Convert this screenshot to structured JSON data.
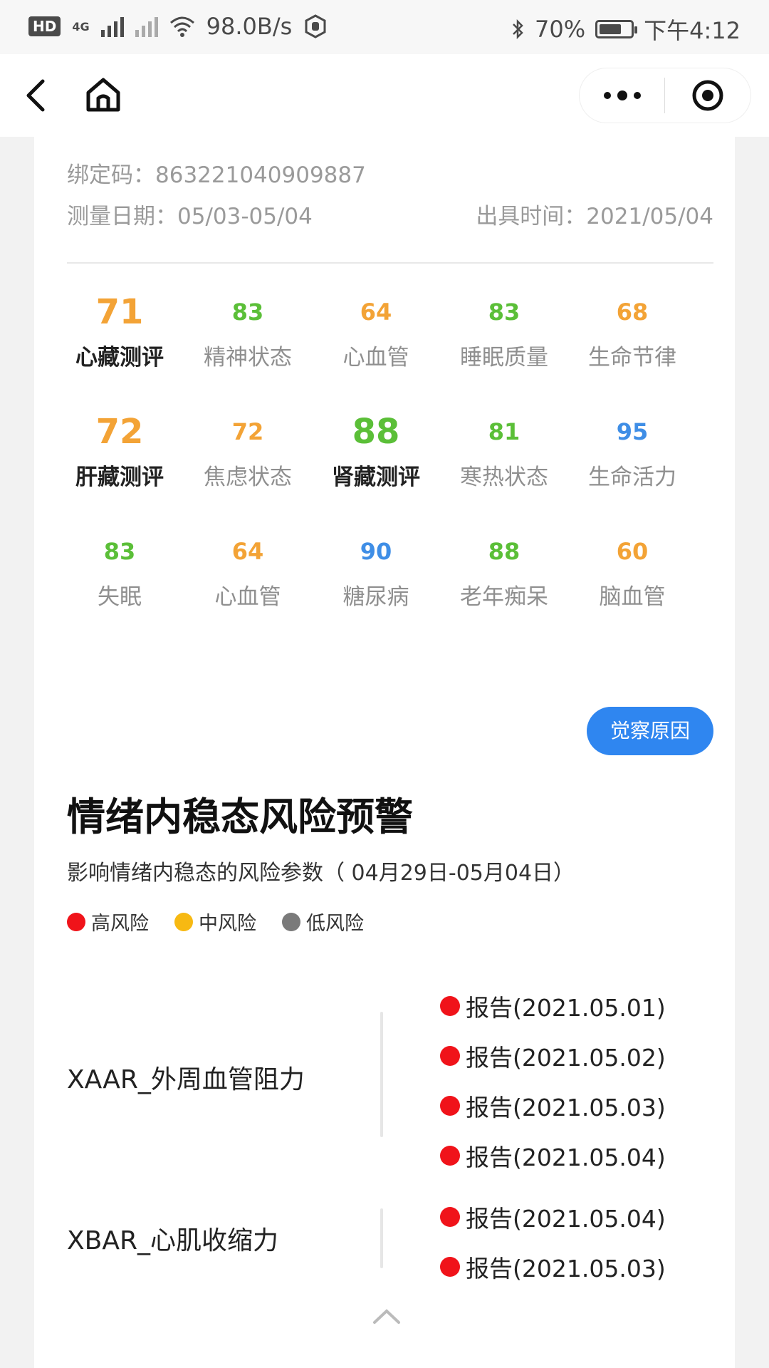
{
  "status_bar": {
    "hd": "HD",
    "network": "4G",
    "speed": "98.0B/s",
    "battery": "70%",
    "time": "下午4:12",
    "battery_level": 0.7
  },
  "card": {
    "binding_code": "绑定码：863221040909887",
    "measure_date": "测量日期：05/03-05/04",
    "issue_time": "出具时间：2021/05/04"
  },
  "scores": [
    [
      {
        "value": "71",
        "label": "心藏测评",
        "color": "#f3a336",
        "emph": true
      },
      {
        "value": "83",
        "label": "精神状态",
        "color": "#5bbf38",
        "emph": false
      },
      {
        "value": "64",
        "label": "心血管",
        "color": "#f3a336",
        "emph": false
      },
      {
        "value": "83",
        "label": "睡眠质量",
        "color": "#5bbf38",
        "emph": false
      },
      {
        "value": "68",
        "label": "生命节律",
        "color": "#f3a336",
        "emph": false
      }
    ],
    [
      {
        "value": "72",
        "label": "肝藏测评",
        "color": "#f3a336",
        "emph": true
      },
      {
        "value": "72",
        "label": "焦虑状态",
        "color": "#f3a336",
        "emph": false
      },
      {
        "value": "88",
        "label": "肾藏测评",
        "color": "#5bbf38",
        "emph": true
      },
      {
        "value": "81",
        "label": "寒热状态",
        "color": "#5bbf38",
        "emph": false
      },
      {
        "value": "95",
        "label": "生命活力",
        "color": "#3f8ee6",
        "emph": false
      }
    ],
    [
      {
        "value": "83",
        "label": "失眠",
        "color": "#5bbf38",
        "emph": false
      },
      {
        "value": "64",
        "label": "心血管",
        "color": "#f3a336",
        "emph": false
      },
      {
        "value": "90",
        "label": "糖尿病",
        "color": "#3f8ee6",
        "emph": false
      },
      {
        "value": "88",
        "label": "老年痴呆",
        "color": "#5bbf38",
        "emph": false
      },
      {
        "value": "60",
        "label": "脑血管",
        "color": "#f3a336",
        "emph": false
      }
    ]
  ],
  "cause_button": "觉察原因",
  "risk": {
    "title": "情绪内稳态风险预警",
    "subtitle": "影响情绪内稳态的风险参数（ 04月29日-05月04日）",
    "legend": {
      "high": "高风险",
      "mid": "中风险",
      "low": "低风险"
    },
    "colors": {
      "high": "#f0131a",
      "mid": "#f7b912",
      "low": "#7a7a7a"
    },
    "params": [
      {
        "name": "XAAR_外周血管阻力",
        "reports": [
          "报告(2021.05.01)",
          "报告(2021.05.02)",
          "报告(2021.05.03)",
          "报告(2021.05.04)"
        ]
      },
      {
        "name": "XBAR_心肌收缩力",
        "reports": [
          "报告(2021.05.04)",
          "报告(2021.05.03)"
        ]
      }
    ]
  },
  "icons": {
    "back": "back-arrow-icon",
    "home": "home-icon",
    "more": "more-dots-icon",
    "target": "target-circle-icon",
    "bluetooth": "bluetooth-icon",
    "wifi": "wifi-icon",
    "hand": "hand-icon",
    "collapse": "chevron-up-icon"
  }
}
